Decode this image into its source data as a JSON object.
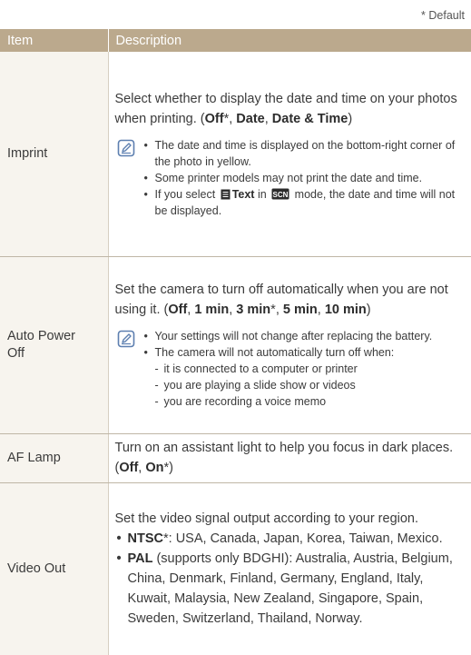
{
  "default_note": "* Default",
  "header": {
    "item": "Item",
    "description": "Description"
  },
  "imprint": {
    "item": "Imprint",
    "desc_lead": "Select whether to display the date and time on your photos when printing. (",
    "opt1": "Off",
    "star1": "*",
    "sep1": ", ",
    "opt2": "Date",
    "sep2": ", ",
    "opt3": "Date & Time",
    "close": ")",
    "note1": "The date and time is displayed on the bottom-right corner of the photo in yellow.",
    "note2": "Some printer models may not print the date and time.",
    "note3_pre": "If you select",
    "note3_text": "Text",
    "note3_mid": "in",
    "note3_post": "mode, the date and time will not be displayed."
  },
  "auto_power_off": {
    "item": "Auto Power Off",
    "desc_lead": "Set the camera to turn off automatically when you are not using it. (",
    "opt1": "Off",
    "sep1": ", ",
    "opt2": "1 min",
    "sep2": ", ",
    "opt3": "3 min",
    "star3": "*",
    "sep3": ", ",
    "opt4": "5 min",
    "sep4": ", ",
    "opt5": "10 min",
    "close": ")",
    "note1": "Your settings will not change after replacing the battery.",
    "note2": "The camera will not automatically turn off when:",
    "sub1": "it is connected to a computer or printer",
    "sub2": "you are playing a slide show or videos",
    "sub3": "you are recording a voice memo"
  },
  "af_lamp": {
    "item": "AF Lamp",
    "desc_lead": "Turn on an assistant light to help you focus in dark places. (",
    "opt1": "Off",
    "sep1": ", ",
    "opt2": "On",
    "star2": "*",
    "close": ")"
  },
  "video_out": {
    "item": "Video Out",
    "desc_lead": "Set the video signal output according to your region.",
    "ntsc_label": "NTSC",
    "ntsc_star": "*",
    "ntsc_text": ": USA, Canada, Japan, Korea, Taiwan, Mexico.",
    "pal_label": "PAL",
    "pal_text": " (supports only BDGHI): Australia, Austria, Belgium, China, Denmark, Finland, Germany, England, Italy, Kuwait, Malaysia, New Zealand, Singapore, Spain, Sweden, Switzerland, Thailand, Norway."
  },
  "icons": {
    "note": "note-pencil-icon",
    "text_menu": "text-menu-icon",
    "scene_mode": "scene-mode-icon"
  },
  "colors": {
    "header_bg": "#bba98d",
    "item_bg": "#f7f4ee"
  }
}
